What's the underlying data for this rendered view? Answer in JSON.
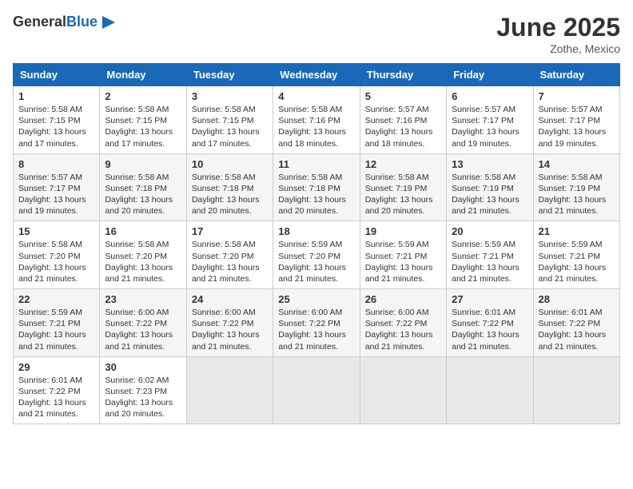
{
  "logo": {
    "general": "General",
    "blue": "Blue"
  },
  "header": {
    "title": "June 2025",
    "location": "Zothe, Mexico"
  },
  "days_of_week": [
    "Sunday",
    "Monday",
    "Tuesday",
    "Wednesday",
    "Thursday",
    "Friday",
    "Saturday"
  ],
  "weeks": [
    [
      {
        "day": "1",
        "sunrise": "5:58 AM",
        "sunset": "7:15 PM",
        "daylight": "13 hours and 17 minutes."
      },
      {
        "day": "2",
        "sunrise": "5:58 AM",
        "sunset": "7:15 PM",
        "daylight": "13 hours and 17 minutes."
      },
      {
        "day": "3",
        "sunrise": "5:58 AM",
        "sunset": "7:15 PM",
        "daylight": "13 hours and 17 minutes."
      },
      {
        "day": "4",
        "sunrise": "5:58 AM",
        "sunset": "7:16 PM",
        "daylight": "13 hours and 18 minutes."
      },
      {
        "day": "5",
        "sunrise": "5:57 AM",
        "sunset": "7:16 PM",
        "daylight": "13 hours and 18 minutes."
      },
      {
        "day": "6",
        "sunrise": "5:57 AM",
        "sunset": "7:17 PM",
        "daylight": "13 hours and 19 minutes."
      },
      {
        "day": "7",
        "sunrise": "5:57 AM",
        "sunset": "7:17 PM",
        "daylight": "13 hours and 19 minutes."
      }
    ],
    [
      {
        "day": "8",
        "sunrise": "5:57 AM",
        "sunset": "7:17 PM",
        "daylight": "13 hours and 19 minutes."
      },
      {
        "day": "9",
        "sunrise": "5:58 AM",
        "sunset": "7:18 PM",
        "daylight": "13 hours and 20 minutes."
      },
      {
        "day": "10",
        "sunrise": "5:58 AM",
        "sunset": "7:18 PM",
        "daylight": "13 hours and 20 minutes."
      },
      {
        "day": "11",
        "sunrise": "5:58 AM",
        "sunset": "7:18 PM",
        "daylight": "13 hours and 20 minutes."
      },
      {
        "day": "12",
        "sunrise": "5:58 AM",
        "sunset": "7:19 PM",
        "daylight": "13 hours and 20 minutes."
      },
      {
        "day": "13",
        "sunrise": "5:58 AM",
        "sunset": "7:19 PM",
        "daylight": "13 hours and 21 minutes."
      },
      {
        "day": "14",
        "sunrise": "5:58 AM",
        "sunset": "7:19 PM",
        "daylight": "13 hours and 21 minutes."
      }
    ],
    [
      {
        "day": "15",
        "sunrise": "5:58 AM",
        "sunset": "7:20 PM",
        "daylight": "13 hours and 21 minutes."
      },
      {
        "day": "16",
        "sunrise": "5:58 AM",
        "sunset": "7:20 PM",
        "daylight": "13 hours and 21 minutes."
      },
      {
        "day": "17",
        "sunrise": "5:58 AM",
        "sunset": "7:20 PM",
        "daylight": "13 hours and 21 minutes."
      },
      {
        "day": "18",
        "sunrise": "5:59 AM",
        "sunset": "7:20 PM",
        "daylight": "13 hours and 21 minutes."
      },
      {
        "day": "19",
        "sunrise": "5:59 AM",
        "sunset": "7:21 PM",
        "daylight": "13 hours and 21 minutes."
      },
      {
        "day": "20",
        "sunrise": "5:59 AM",
        "sunset": "7:21 PM",
        "daylight": "13 hours and 21 minutes."
      },
      {
        "day": "21",
        "sunrise": "5:59 AM",
        "sunset": "7:21 PM",
        "daylight": "13 hours and 21 minutes."
      }
    ],
    [
      {
        "day": "22",
        "sunrise": "5:59 AM",
        "sunset": "7:21 PM",
        "daylight": "13 hours and 21 minutes."
      },
      {
        "day": "23",
        "sunrise": "6:00 AM",
        "sunset": "7:22 PM",
        "daylight": "13 hours and 21 minutes."
      },
      {
        "day": "24",
        "sunrise": "6:00 AM",
        "sunset": "7:22 PM",
        "daylight": "13 hours and 21 minutes."
      },
      {
        "day": "25",
        "sunrise": "6:00 AM",
        "sunset": "7:22 PM",
        "daylight": "13 hours and 21 minutes."
      },
      {
        "day": "26",
        "sunrise": "6:00 AM",
        "sunset": "7:22 PM",
        "daylight": "13 hours and 21 minutes."
      },
      {
        "day": "27",
        "sunrise": "6:01 AM",
        "sunset": "7:22 PM",
        "daylight": "13 hours and 21 minutes."
      },
      {
        "day": "28",
        "sunrise": "6:01 AM",
        "sunset": "7:22 PM",
        "daylight": "13 hours and 21 minutes."
      }
    ],
    [
      {
        "day": "29",
        "sunrise": "6:01 AM",
        "sunset": "7:22 PM",
        "daylight": "13 hours and 21 minutes."
      },
      {
        "day": "30",
        "sunrise": "6:02 AM",
        "sunset": "7:23 PM",
        "daylight": "13 hours and 20 minutes."
      },
      null,
      null,
      null,
      null,
      null
    ]
  ],
  "labels": {
    "sunrise": "Sunrise:",
    "sunset": "Sunset:",
    "daylight": "Daylight:"
  }
}
